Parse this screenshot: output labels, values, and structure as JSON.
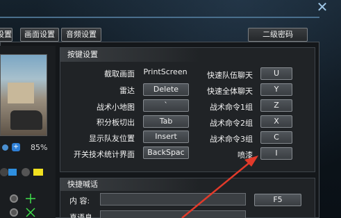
{
  "window": {
    "close_glyph": "✕"
  },
  "tabs": [
    {
      "label": "设置"
    },
    {
      "label": "画面设置"
    },
    {
      "label": "音频设置"
    }
  ],
  "secondary_password_button": "二级密码",
  "left_panel": {
    "volume_percent": "85%"
  },
  "hotkeys": {
    "header": "按键设置",
    "left_items": [
      {
        "label": "截取画面",
        "key": "PrintScreen"
      },
      {
        "label": "雷达",
        "key": "Delete"
      },
      {
        "label": "战术小地图",
        "key": "`"
      },
      {
        "label": "积分板切出",
        "key": "Tab"
      },
      {
        "label": "显示队友位置",
        "key": "Insert"
      },
      {
        "label": "开关技术统计界面",
        "key": "BackSpac"
      }
    ],
    "right_items": [
      {
        "label": "快速队伍聊天",
        "key": "U"
      },
      {
        "label": "快速全体聊天",
        "key": "Y"
      },
      {
        "label": "战术命令1组",
        "key": "Z"
      },
      {
        "label": "战术命令2组",
        "key": "X"
      },
      {
        "label": "战术命令3组",
        "key": "C"
      },
      {
        "label": "喷漆",
        "key": "I"
      }
    ]
  },
  "quick_chat": {
    "header": "快捷喊话",
    "content_label": "内    容:",
    "content_key": "F5",
    "second_label": "喜语息"
  },
  "colors": {
    "accent_blue": "#2e7fd6",
    "arrow_red": "#e23a2a"
  }
}
